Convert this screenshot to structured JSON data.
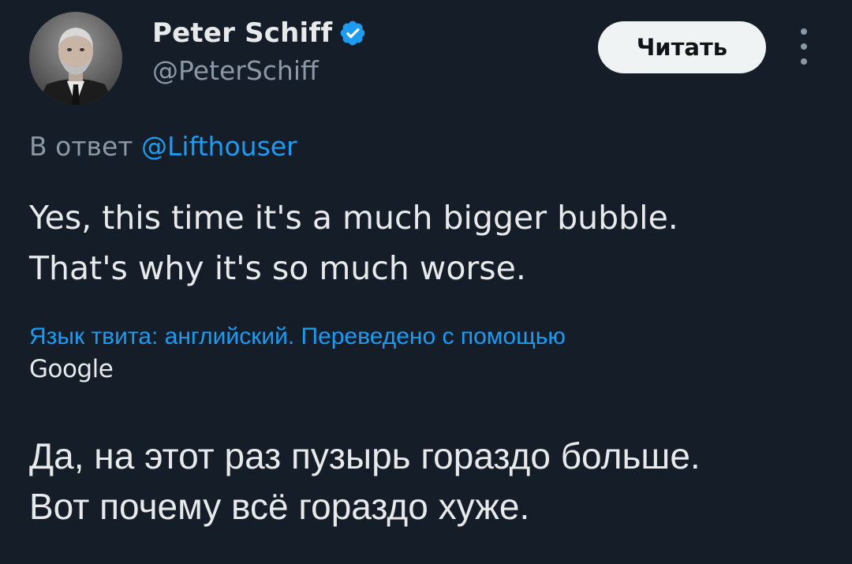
{
  "author": {
    "display_name": "Peter Schiff",
    "handle": "@PeterSchiff",
    "verified": true,
    "avatar_icon": "avatar-photo"
  },
  "follow_button": {
    "label": "Читать"
  },
  "more_menu": {
    "icon": "more-vertical-icon"
  },
  "reply": {
    "prefix": "В ответ ",
    "mention": "@Lifthouser"
  },
  "tweet": {
    "lines": [
      "Yes, this time it's a much bigger bubble.",
      "That's why it's so much worse."
    ]
  },
  "translation": {
    "note": "Язык твита: английский. Переведено с помощью",
    "provider": "Google",
    "lines": [
      "Да, на этот раз пузырь гораздо больше.",
      "Вот почему всё гораздо хуже."
    ]
  },
  "colors": {
    "background": "#151d28",
    "text_primary": "#e7e9ea",
    "text_secondary": "#8b98a5",
    "accent": "#1d9bf0",
    "button_bg": "#eff3f4"
  }
}
